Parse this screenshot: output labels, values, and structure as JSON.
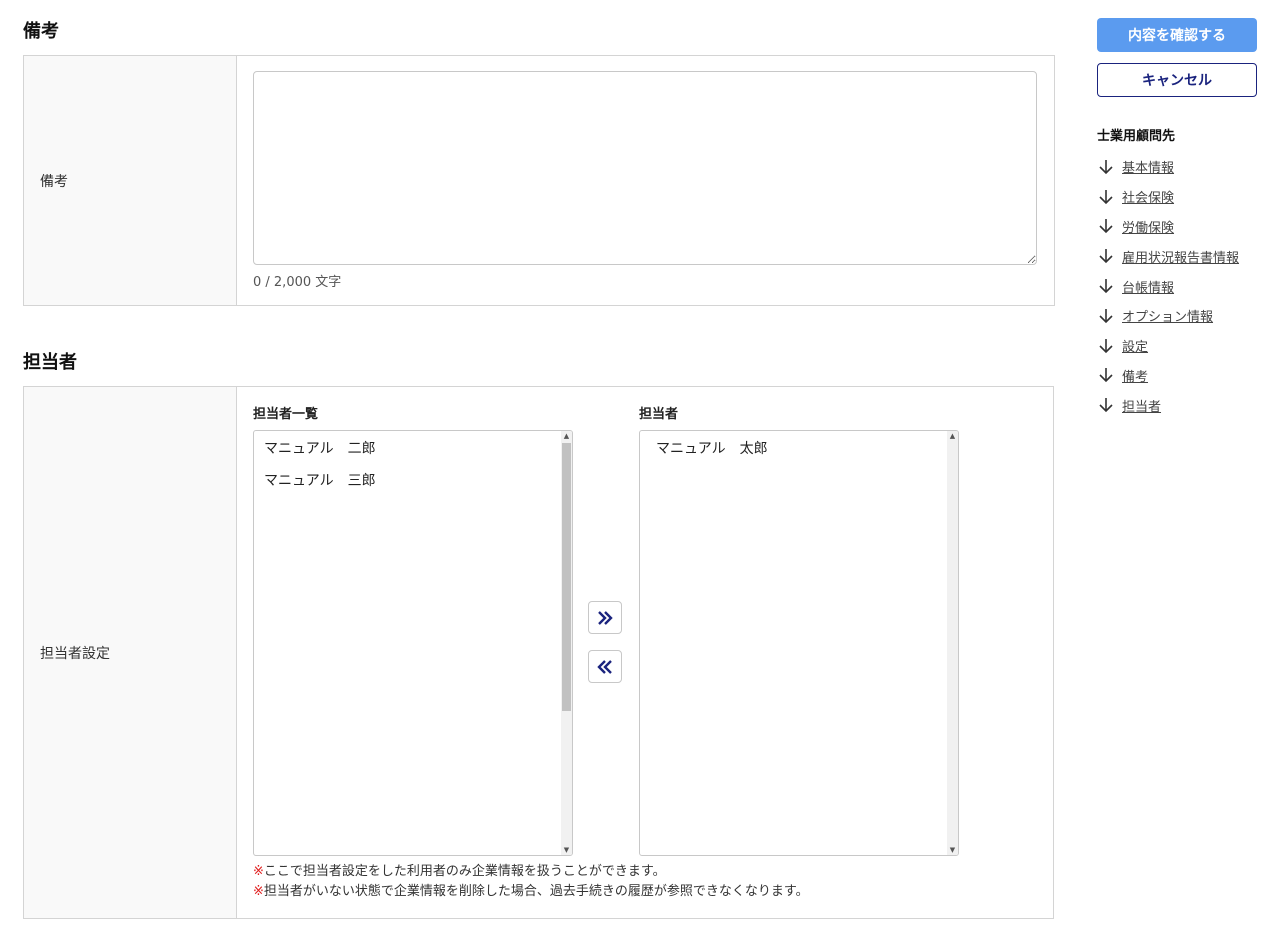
{
  "remarks": {
    "heading": "備考",
    "label": "備考",
    "textarea_value": "",
    "counter": "0 / 2,000 文字"
  },
  "staff": {
    "heading": "担当者",
    "label": "担当者設定",
    "available_title": "担当者一覧",
    "available": [
      "マニュアル　二郎",
      "マニュアル　三郎"
    ],
    "assigned_title": "担当者",
    "assigned": [
      "マニュアル　太郎"
    ],
    "notes": [
      {
        "mark": "※",
        "text": "ここで担当者設定をした利用者のみ企業情報を扱うことができます。"
      },
      {
        "mark": "※",
        "text": "担当者がいない状態で企業情報を削除した場合、過去手続きの履歴が参照できなくなります。"
      }
    ]
  },
  "actions": {
    "confirm_label": "内容を確認する",
    "cancel_label": "キャンセル"
  },
  "nav": {
    "title": "士業用顧問先",
    "items": [
      "基本情報",
      "社会保険",
      "労働保険",
      "雇用状況報告書情報",
      "台帳情報",
      "オプション情報",
      "設定",
      "備考",
      "担当者"
    ]
  },
  "colors": {
    "primary": "#5b9bef",
    "accent_navy": "#1a237e",
    "note_mark": "#e02020"
  }
}
